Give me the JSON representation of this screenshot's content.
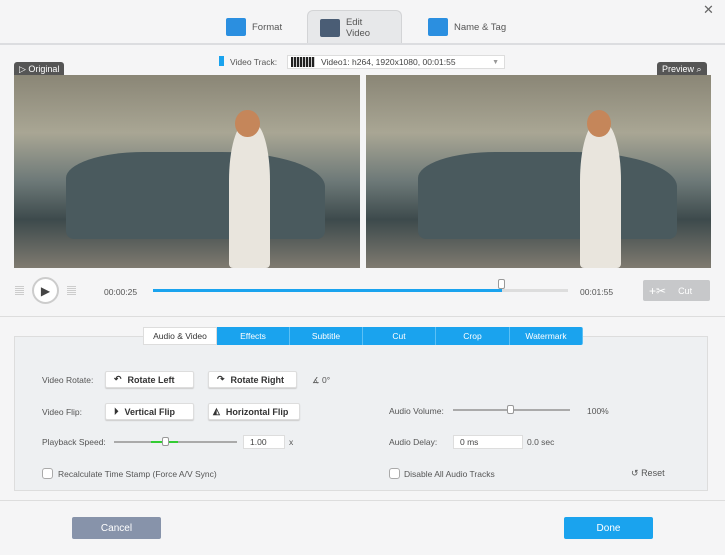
{
  "tabs": [
    {
      "label": "Format",
      "icon": "format-icon"
    },
    {
      "label": "Edit Video",
      "icon": "edit-video-icon",
      "active": true
    },
    {
      "label": "Name & Tag",
      "icon": "name-tag-icon"
    }
  ],
  "close_icon": "close-icon",
  "video_track": {
    "label": "Video Track:",
    "value": "Video1: h264, 1920x1080, 00:01:55"
  },
  "original_label": "Original",
  "preview_label": "Preview",
  "player": {
    "current": "00:00:25",
    "total": "00:01:55",
    "progress": 0.84,
    "cut_label": "Cut"
  },
  "panel_tabs": [
    "Audio & Video",
    "Effects",
    "Subtitle",
    "Cut",
    "Crop",
    "Watermark"
  ],
  "panel": {
    "rotate_label": "Video Rotate:",
    "rotate_left": "Rotate Left",
    "rotate_right": "Rotate Right",
    "angle": "0°",
    "flip_label": "Video Flip:",
    "vertical_flip": "Vertical Flip",
    "horizontal_flip": "Horizontal Flip",
    "speed_label": "Playback Speed:",
    "speed_value": "1.00",
    "speed_unit": "x",
    "volume_label": "Audio Volume:",
    "volume_value": "100%",
    "delay_label": "Audio Delay:",
    "delay_value": "0 ms",
    "delay_sec": "0.0 sec",
    "recalc_label": "Recalculate Time Stamp (Force A/V Sync)",
    "recalc_checked": false,
    "disable_audio_label": "Disable All Audio Tracks",
    "disable_audio_checked": false,
    "reset_label": "Reset"
  },
  "footer": {
    "cancel": "Cancel",
    "done": "Done"
  },
  "colors": {
    "accent": "#1aa3ee",
    "cancel": "#8793aa"
  }
}
